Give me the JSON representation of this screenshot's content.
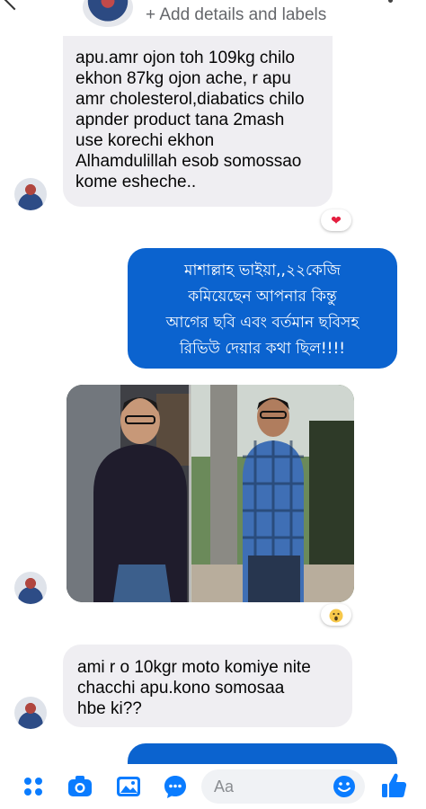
{
  "header": {
    "add_details": "+ Add details and labels"
  },
  "messages": [
    {
      "type": "received",
      "text": "apu.amr ojon toh 109kg chilo\nekhon 87kg ojon ache, r apu\namr cholesterol,diabatics chilo\napnder product tana 2mash\nuse korechi ekhon\nAlhamdulillah esob somossao\nkome esheche..",
      "reaction_icon": "heart-icon",
      "reaction_color": "#e41e3f"
    },
    {
      "type": "sent",
      "text": "মাশাল্লাহ ভাইয়া,,২২কেজি\nকমিয়েছেন আপনার কিন্তু\nআগের ছবি এবং বর্তমান ছবিসহ\nরিভিউ দেয়ার কথা ছিল!!!!"
    },
    {
      "type": "received_photo",
      "image_icon": "before-after-photo",
      "reaction_icon": "wow-emoji-icon"
    },
    {
      "type": "received",
      "text": "ami r o 10kgr moto komiye nite\nchacchi apu.kono somosaa\nhbe ki??"
    }
  ],
  "composer": {
    "placeholder": "Aa"
  },
  "toolbar": {
    "icons": [
      "menu-dots-icon",
      "camera-icon",
      "gallery-icon",
      "voice-icon",
      "emoji-icon",
      "like-icon"
    ]
  },
  "colors": {
    "accent": "#0b63cf",
    "received_bubble": "#efeef2",
    "toolbar_icon": "#0a7cff"
  }
}
